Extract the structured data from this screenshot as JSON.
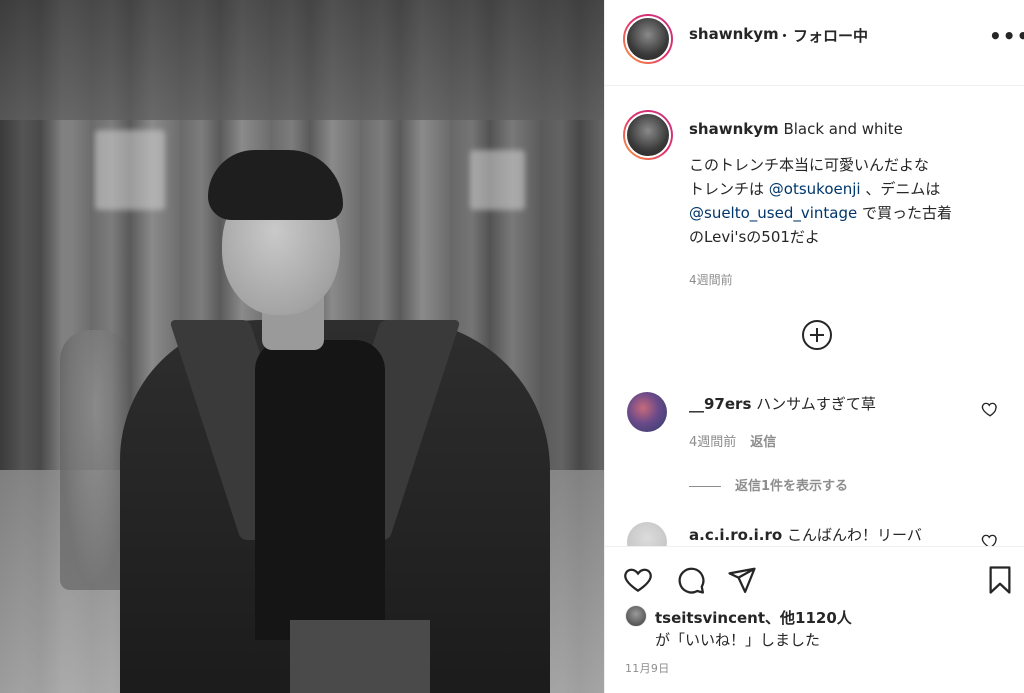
{
  "post": {
    "image_alt": "Black and white"
  },
  "header": {
    "username": "shawnkym",
    "separator": "・",
    "follow_status": "フォロー中",
    "more_icon": "•••"
  },
  "caption": {
    "username": "shawnkym",
    "title": "Black and white",
    "line1": "このトレンチ本当に可愛いんだよな",
    "line2_prefix": "トレンチは ",
    "mention1": "@otsukoenji",
    "line2_suffix": " 、デニムは",
    "mention2": "@suelto_used_vintage",
    "line3_suffix": " で買った古着",
    "line4": "のLevi'sの501だよ",
    "time": "4週間前"
  },
  "comments": [
    {
      "username": "__97ers",
      "text": "ハンサムすぎて草",
      "time": "4週間前",
      "reply_label": "返信",
      "view_replies": "返信1件を表示する"
    },
    {
      "username": "a.c.i.ro.i.ro",
      "text": "こんばんわ！リーバ"
    }
  ],
  "likes": {
    "line1": "tseitsvincent、他1120人",
    "line2": "が「いいね！」しました"
  },
  "date": "11月9日",
  "icons": {
    "like": "heart-icon",
    "comment": "comment-icon",
    "share": "share-icon",
    "save": "bookmark-icon",
    "add_comment": "plus-circle-icon",
    "comment_like": "heart-icon"
  },
  "colors": {
    "mention": "#00376b",
    "muted": "#8e8e8e",
    "text": "#262626"
  }
}
